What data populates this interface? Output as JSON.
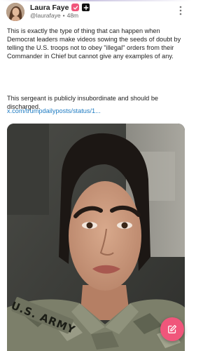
{
  "post": {
    "author": {
      "display_name": "Laura Faye",
      "handle": "@laurafaye",
      "separator": "•",
      "time_ago": "48m",
      "verified_icon": "verified-check-icon",
      "badge_icon": "plus-badge-icon"
    },
    "more_icon": "more-vertical-icon",
    "text": {
      "paragraph_1": "This is exactly the type of thing that can happen when Democrat leaders make videos sowing the seeds of doubt by telling the U.S. troops not to obey \"illegal\" orders from their Commander in Chief but cannot give any examples of any.",
      "paragraph_2": "This sergeant is publicly insubordinate and should be discharged."
    },
    "link": "x.com/trumpdailyposts/status/1...",
    "video": {
      "uniform_patch_text": "U.S. ARMY"
    }
  },
  "compose": {
    "icon": "compose-pencil-icon"
  },
  "colors": {
    "accent_pink": "#f0567b",
    "link_blue": "#1e7bc2"
  }
}
